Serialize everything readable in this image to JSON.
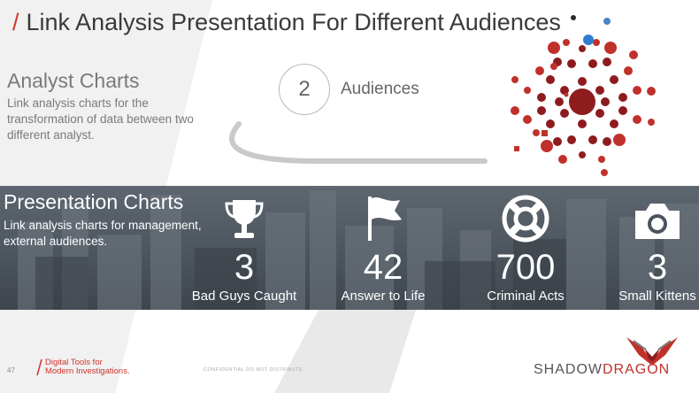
{
  "title": "Link Analysis Presentation For Different Audiences",
  "title_slash": "/",
  "analyst": {
    "heading": "Analyst Charts",
    "description": "Link analysis charts for the transformation of data between two different analyst."
  },
  "audiences": {
    "count": "2",
    "label": "Audiences"
  },
  "presentation": {
    "heading": "Presentation Charts",
    "description": "Link analysis charts for management, external audiences."
  },
  "stats": [
    {
      "number": "3",
      "label": "Bad Guys Caught",
      "icon": "trophy-icon"
    },
    {
      "number": "42",
      "label": "Answer to Life",
      "icon": "flag-icon"
    },
    {
      "number": "700",
      "label": "Criminal Acts",
      "icon": "lifebuoy-icon"
    },
    {
      "number": "3",
      "label": "Small Kittens",
      "icon": "camera-icon"
    }
  ],
  "footer": {
    "page_number": "47",
    "tagline_line1": "Digital Tools for",
    "tagline_line2": "Modern Investigations.",
    "confidential": "CONFIDENTIAL DO NOT DISTRIBUTE",
    "brand_part1": "SHADOW",
    "brand_part2": "DRAGON"
  },
  "colors": {
    "accent_red": "#d0342c",
    "dark_red": "#8e1c1f",
    "blue": "#2e7bcf",
    "band_gray": "#4b535c"
  }
}
